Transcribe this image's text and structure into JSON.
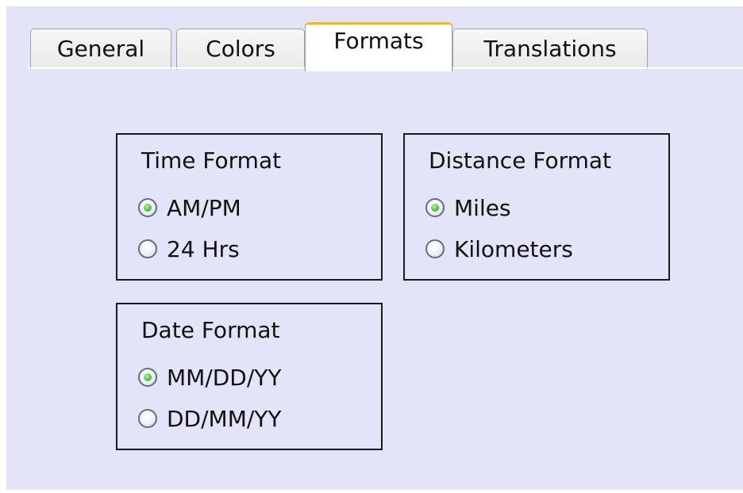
{
  "tabs": [
    {
      "label": "General",
      "active": false
    },
    {
      "label": "Colors",
      "active": false
    },
    {
      "label": "Formats",
      "active": true
    },
    {
      "label": "Translations",
      "active": false
    }
  ],
  "groups": {
    "time_format": {
      "title": "Time Format",
      "options": [
        {
          "label": "AM/PM",
          "selected": true
        },
        {
          "label": "24 Hrs",
          "selected": false
        }
      ]
    },
    "distance_format": {
      "title": "Distance Format",
      "options": [
        {
          "label": "Miles",
          "selected": true
        },
        {
          "label": "Kilometers",
          "selected": false
        }
      ]
    },
    "date_format": {
      "title": "Date Format",
      "options": [
        {
          "label": "MM/DD/YY",
          "selected": true
        },
        {
          "label": "DD/MM/YY",
          "selected": false
        }
      ]
    }
  },
  "colors": {
    "background": "#e4e4f8",
    "active_tab_accent": "#f2b33a",
    "radio_checked": "#4fbf3c"
  }
}
